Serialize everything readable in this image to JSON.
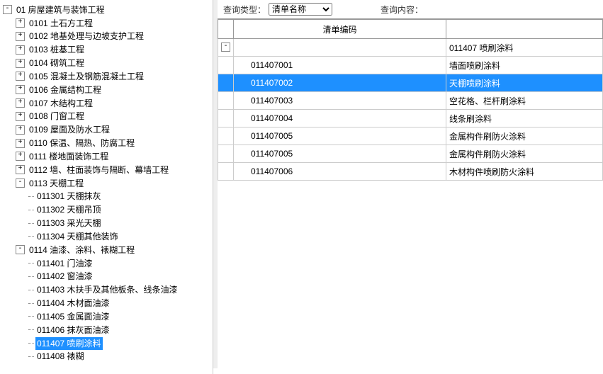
{
  "query_bar": {
    "type_label": "查询类型：",
    "type_value": "清单名称",
    "content_label": "查询内容："
  },
  "table": {
    "columns": [
      "清单编码",
      ""
    ],
    "group_row": {
      "code": "",
      "name": "011407 喷刷涂料"
    },
    "rows": [
      {
        "code": "011407001",
        "name": "墙面喷刷涂料",
        "selected": false
      },
      {
        "code": "011407002",
        "name": "天棚喷刷涂料",
        "selected": true
      },
      {
        "code": "011407003",
        "name": "空花格、栏杆刷涂料",
        "selected": false
      },
      {
        "code": "011407004",
        "name": "线条刷涂料",
        "selected": false
      },
      {
        "code": "011407005",
        "name": "金属构件刷防火涂料",
        "selected": false
      },
      {
        "code": "011407005",
        "name": "金属构件刷防火涂料",
        "selected": false
      },
      {
        "code": "011407006",
        "name": "木材构件喷刷防火涂料",
        "selected": false
      }
    ]
  },
  "tree": [
    {
      "label": "01 房屋建筑与装饰工程",
      "expanded": true,
      "children": [
        {
          "label": "0101 土石方工程"
        },
        {
          "label": "0102 地基处理与边坡支护工程"
        },
        {
          "label": "0103 桩基工程"
        },
        {
          "label": "0104 砌筑工程"
        },
        {
          "label": "0105 混凝土及钢筋混凝土工程"
        },
        {
          "label": "0106 金属结构工程"
        },
        {
          "label": "0107 木结构工程"
        },
        {
          "label": "0108 门窗工程"
        },
        {
          "label": "0109 屋面及防水工程"
        },
        {
          "label": "0110 保温、隔热、防腐工程"
        },
        {
          "label": "0111 楼地面装饰工程"
        },
        {
          "label": "0112 墙、柱面装饰与隔断、幕墙工程"
        },
        {
          "label": "0113 天棚工程",
          "expanded": true,
          "children": [
            {
              "label": "011301 天棚抹灰",
              "leaf": true
            },
            {
              "label": "011302 天棚吊顶",
              "leaf": true
            },
            {
              "label": "011303 采光天棚",
              "leaf": true
            },
            {
              "label": "011304 天棚其他装饰",
              "leaf": true
            }
          ]
        },
        {
          "label": "0114 油漆、涂料、裱糊工程",
          "expanded": true,
          "children": [
            {
              "label": "011401 门油漆",
              "leaf": true
            },
            {
              "label": "011402 窗油漆",
              "leaf": true
            },
            {
              "label": "011403 木扶手及其他板条、线条油漆",
              "leaf": true
            },
            {
              "label": "011404 木材面油漆",
              "leaf": true
            },
            {
              "label": "011405 金属面油漆",
              "leaf": true
            },
            {
              "label": "011406 抹灰面油漆",
              "leaf": true
            },
            {
              "label": "011407 喷刷涂料",
              "leaf": true,
              "selected": true
            },
            {
              "label": "011408 裱糊",
              "leaf": true
            }
          ]
        }
      ]
    }
  ]
}
